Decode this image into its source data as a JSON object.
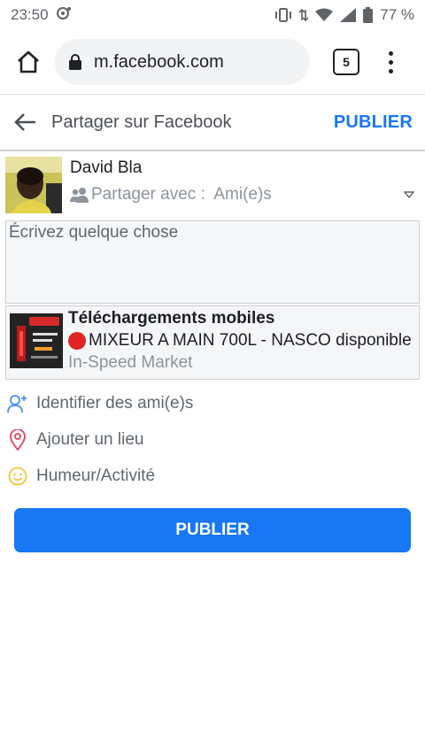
{
  "status_bar": {
    "time": "23:50",
    "battery": "77 %"
  },
  "browser": {
    "url": "m.facebook.com",
    "tab_count": "5"
  },
  "header": {
    "title": "Partager sur Facebook",
    "publish_label": "PUBLIER"
  },
  "composer": {
    "author_name": "David Bla",
    "audience_label": "Partager avec :",
    "audience_value": "Ami(e)s",
    "placeholder": "Écrivez quelque chose"
  },
  "shared_link": {
    "title": "Téléchargements mobiles",
    "description": "MIXEUR A MAIN 700L - NASCO disponible",
    "source": "In-Speed Market"
  },
  "options": [
    {
      "label": "Identifier des ami(e)s",
      "icon": "add-person-icon"
    },
    {
      "label": "Ajouter un lieu",
      "icon": "location-pin-icon"
    },
    {
      "label": "Humeur/Activité",
      "icon": "smiley-icon"
    }
  ],
  "publish_button": "PUBLIER",
  "colors": {
    "brand": "#1877f2",
    "pin": "#e4405f",
    "smiley": "#f5c33b",
    "tag": "#4b8df8"
  }
}
